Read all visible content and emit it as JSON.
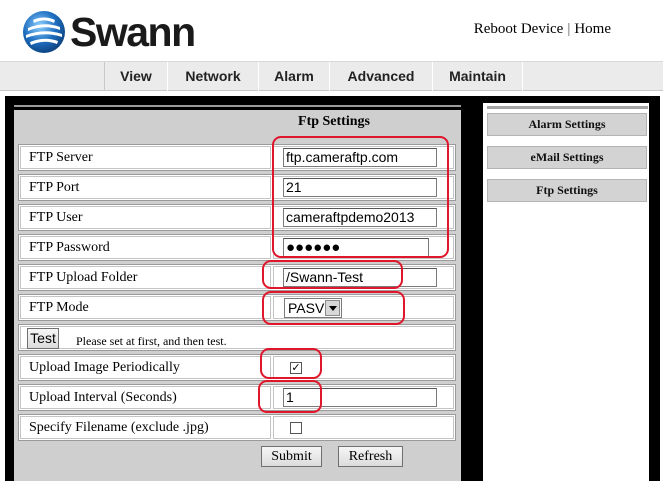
{
  "header": {
    "brand": "Swann",
    "links": {
      "reboot": "Reboot Device",
      "separator": "|",
      "home": "Home"
    }
  },
  "nav": {
    "items": [
      {
        "label": "View"
      },
      {
        "label": "Network"
      },
      {
        "label": "Alarm"
      },
      {
        "label": "Advanced"
      },
      {
        "label": "Maintain"
      }
    ]
  },
  "main": {
    "title": "Ftp Settings",
    "fields": {
      "server": {
        "label": "FTP Server",
        "value": "ftp.cameraftp.com"
      },
      "port": {
        "label": "FTP Port",
        "value": "21"
      },
      "user": {
        "label": "FTP User",
        "value": "cameraftpdemo2013"
      },
      "password": {
        "label": "FTP Password",
        "value": "●●●●●●"
      },
      "upload_folder": {
        "label": "FTP Upload Folder",
        "value": "/Swann-Test"
      },
      "mode": {
        "label": "FTP Mode",
        "value": "PASV"
      },
      "test": {
        "button": "Test",
        "hint": "Please set at first, and then test."
      },
      "upload_periodic": {
        "label": "Upload Image Periodically",
        "checked": true,
        "mark": "✓"
      },
      "upload_interval": {
        "label": "Upload Interval (Seconds)",
        "value": "1"
      },
      "specify_filename": {
        "label": "Specify Filename (exclude .jpg)",
        "checked": false,
        "mark": ""
      }
    },
    "buttons": {
      "submit": "Submit",
      "refresh": "Refresh"
    }
  },
  "sidebar": {
    "items": [
      {
        "label": "Alarm Settings"
      },
      {
        "label": "eMail Settings"
      },
      {
        "label": "Ftp Settings"
      }
    ]
  },
  "colors": {
    "annotation": "#e0162b",
    "background": "#000000",
    "panel": "#cfcfcf",
    "brand_blue": "#1f6fc1"
  },
  "icons": {
    "logo": "swann-globe-logo",
    "select_arrow": "chevron-down-icon",
    "check": "checkmark-icon"
  }
}
